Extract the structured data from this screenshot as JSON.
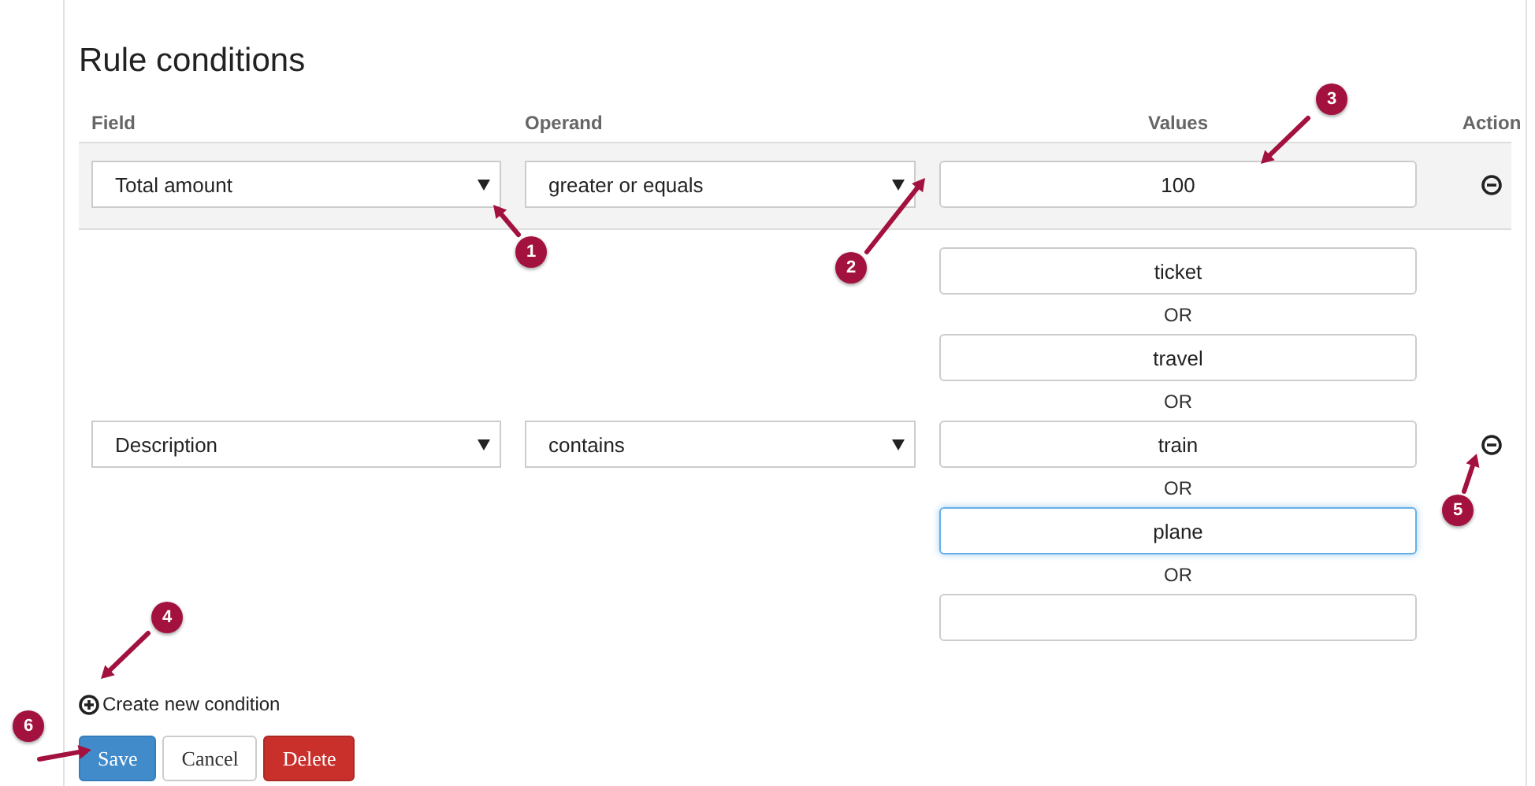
{
  "title": "Rule conditions",
  "columns": [
    {
      "label": "Field"
    },
    {
      "label": "Operand"
    },
    {
      "label": "Values"
    },
    {
      "label": "Action"
    }
  ],
  "conditions": [
    {
      "field": "Total amount",
      "operand": "greater or equals",
      "highlighted": true,
      "values": [
        {
          "value": "100",
          "focused": false
        }
      ]
    },
    {
      "field": "Description",
      "operand": "contains",
      "highlighted": false,
      "values": [
        {
          "value": "ticket",
          "focused": false,
          "joiner": "OR"
        },
        {
          "value": "travel",
          "focused": false,
          "joiner": "OR"
        },
        {
          "value": "train",
          "focused": false,
          "joiner": "OR"
        },
        {
          "value": "plane",
          "focused": true,
          "joiner": "OR"
        },
        {
          "focused": false
        }
      ]
    }
  ],
  "create_link": "Create new condition",
  "buttons": [
    {
      "label": "Save",
      "kind": "primary"
    },
    {
      "label": "Cancel",
      "kind": "default"
    },
    {
      "label": "Delete",
      "kind": "danger"
    }
  ],
  "annotations": [
    {
      "label": "1"
    },
    {
      "label": "2"
    },
    {
      "label": "3"
    },
    {
      "label": "4"
    },
    {
      "label": "5"
    },
    {
      "label": "6"
    }
  ]
}
